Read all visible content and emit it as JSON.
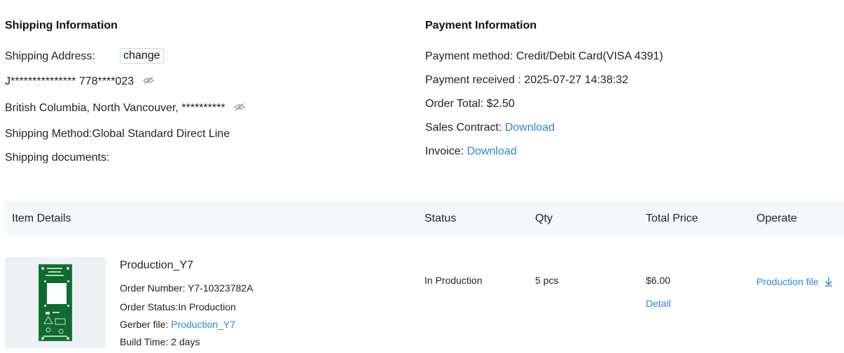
{
  "shipping": {
    "heading": "Shipping Information",
    "address_label": "Shipping Address:",
    "change_label": "change",
    "recipient": "J*************** 778****023",
    "location": "British Columbia, North Vancouver, **********",
    "method": "Shipping Method:Global Standard Direct Line",
    "documents_label": "Shipping documents:"
  },
  "payment": {
    "heading": "Payment Information",
    "method": "Payment method: Credit/Debit Card(VISA 4391)",
    "received": "Payment received : 2025-07-27 14:38:32",
    "total": "Order Total: $2.50",
    "contract_label": "Sales Contract: ",
    "contract_link": "Download",
    "invoice_label": "Invoice: ",
    "invoice_link": "Download"
  },
  "table": {
    "headers": {
      "item": "Item Details",
      "status": "Status",
      "qty": "Qty",
      "price": "Total Price",
      "operate": "Operate"
    },
    "row": {
      "name": "Production_Y7",
      "order_number": "Order Number: Y7-10323782A",
      "order_status": "Order Status:In Production",
      "gerber_label": "Gerber file: ",
      "gerber_link": "Production_Y7",
      "build_time": "Build Time: 2 days",
      "status": "In Production",
      "qty": "5 pcs",
      "price": "$6.00",
      "detail_link": "Detail",
      "production_file_link": "Production file"
    }
  },
  "icons": {
    "hidden": "eye-slash-icon",
    "download": "download-arrow-icon"
  },
  "colors": {
    "link": "#2b86d9",
    "header_bg": "#f5f8fb",
    "pcb_green": "#0f6b2f"
  }
}
